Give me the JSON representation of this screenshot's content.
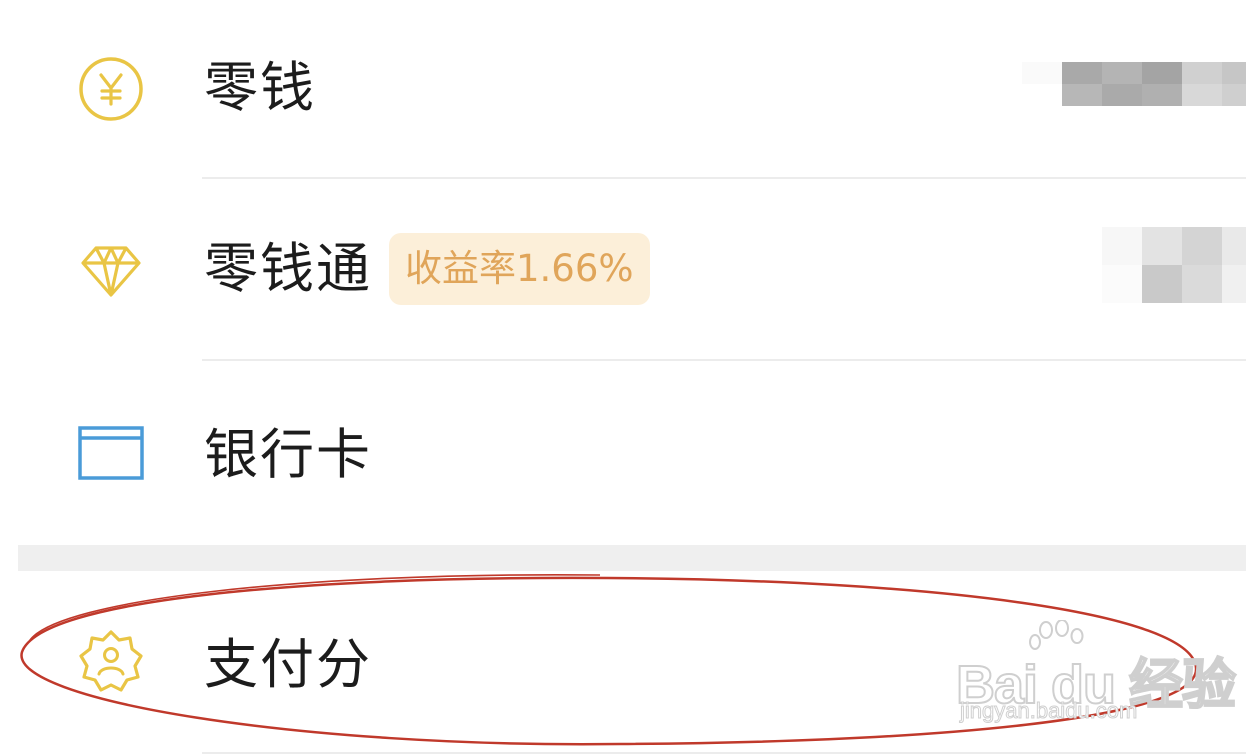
{
  "wallet_menu": {
    "items": [
      {
        "label": "零钱",
        "icon": "yuan-coin-icon"
      },
      {
        "label": "零钱通",
        "icon": "diamond-icon",
        "badge": "收益率1.66%"
      },
      {
        "label": "银行卡",
        "icon": "bank-card-icon"
      }
    ]
  },
  "services_menu": {
    "items": [
      {
        "label": "支付分",
        "icon": "badge-person-icon"
      }
    ]
  },
  "watermark": {
    "brand": "Bai du 经验",
    "url": "jingyan.baidu.com"
  },
  "colors": {
    "yuan_icon": "#E9C545",
    "diamond_icon": "#E9C545",
    "card_icon": "#4A9BD8",
    "score_icon": "#E9C545",
    "badge_bg": "#FCEFD9",
    "badge_text": "#E0A55A",
    "annotation": "#C0392B",
    "separator": "#EFEFEF"
  }
}
